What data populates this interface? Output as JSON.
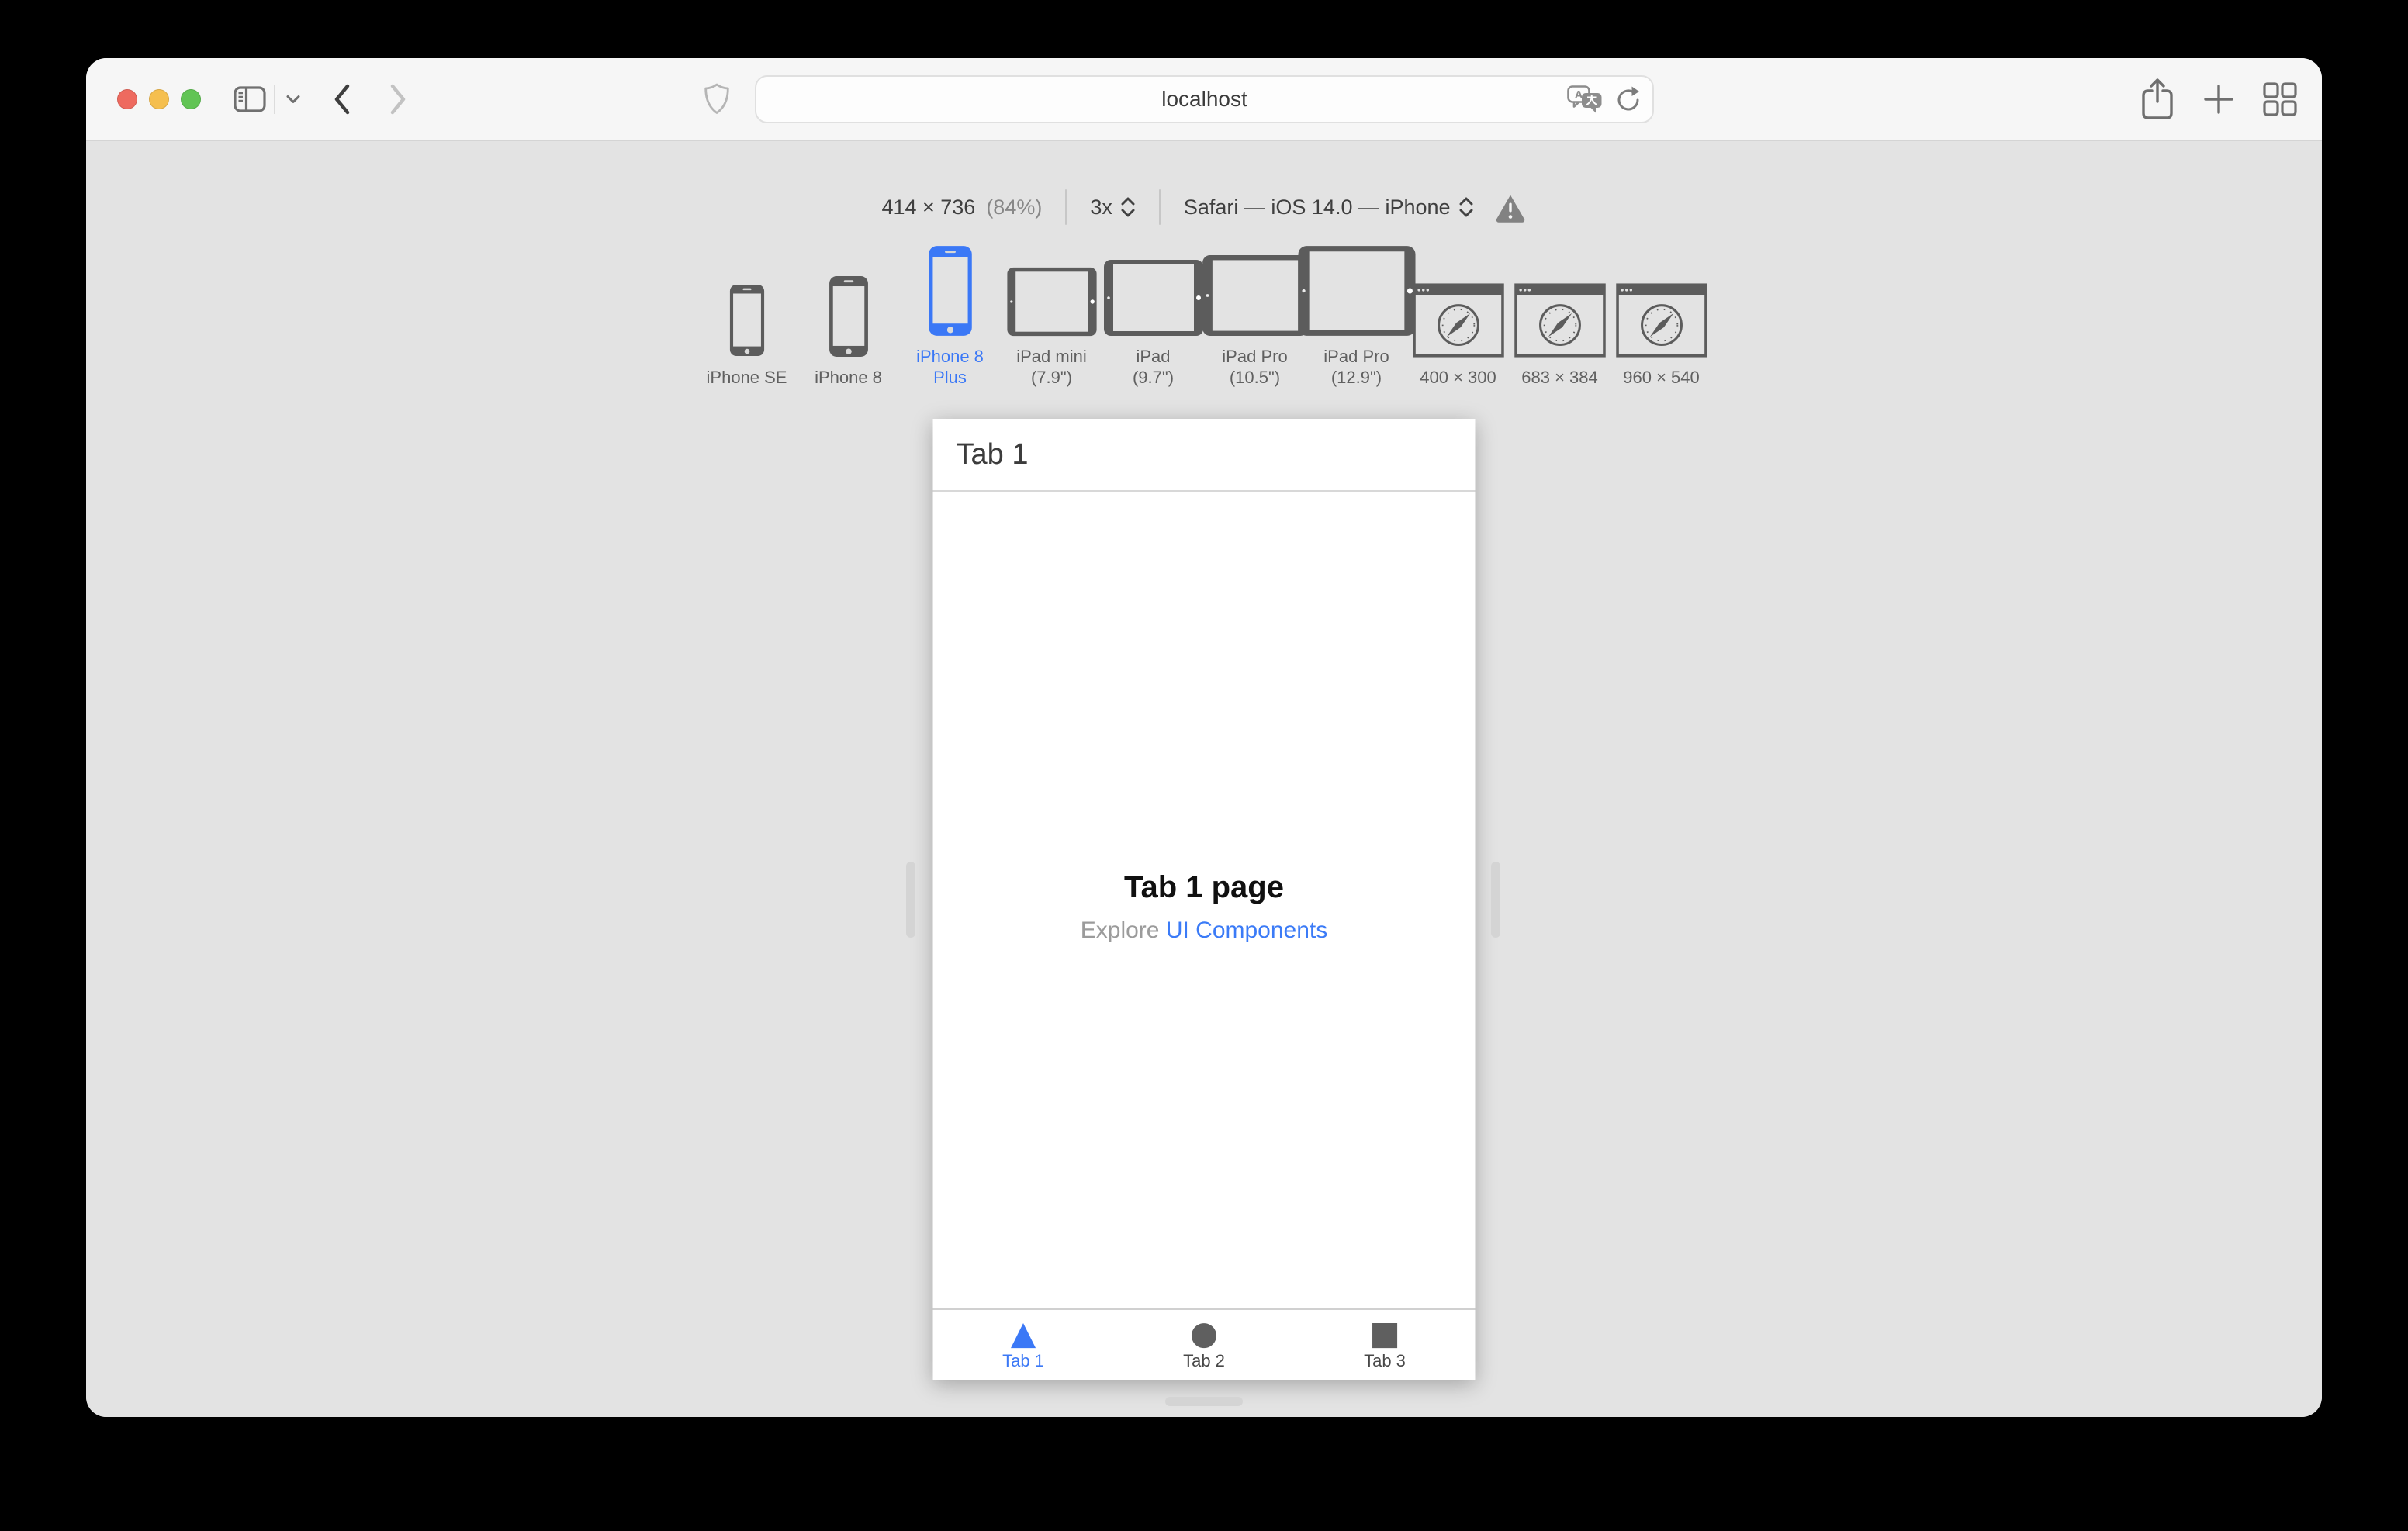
{
  "titlebar": {
    "url": "localhost"
  },
  "rdm": {
    "size": "414 × 736",
    "zoom": "(84%)",
    "pixel_ratio": "3x",
    "environment": "Safari — iOS 14.0 — iPhone"
  },
  "devices": [
    {
      "lines": [
        "iPhone SE"
      ],
      "selected": false
    },
    {
      "lines": [
        "iPhone 8"
      ],
      "selected": false
    },
    {
      "lines": [
        "iPhone 8",
        "Plus"
      ],
      "selected": true
    },
    {
      "lines": [
        "iPad mini",
        "(7.9\")"
      ],
      "selected": false
    },
    {
      "lines": [
        "iPad",
        "(9.7\")"
      ],
      "selected": false
    },
    {
      "lines": [
        "iPad Pro",
        "(10.5\")"
      ],
      "selected": false
    },
    {
      "lines": [
        "iPad Pro",
        "(12.9\")"
      ],
      "selected": false
    },
    {
      "lines": [
        "400 × 300"
      ],
      "selected": false
    },
    {
      "lines": [
        "683 × 384"
      ],
      "selected": false
    },
    {
      "lines": [
        "960 × 540"
      ],
      "selected": false
    }
  ],
  "viewport": {
    "nav_title": "Tab 1",
    "heading": "Tab 1 page",
    "subtext_prefix": "Explore ",
    "subtext_link": "UI Components",
    "tabs": [
      {
        "label": "Tab 1",
        "glyph": "▲",
        "active": true
      },
      {
        "label": "Tab 2",
        "glyph": "●",
        "active": false
      },
      {
        "label": "Tab 3",
        "glyph": "■",
        "active": false
      }
    ]
  },
  "colors": {
    "accent_blue": "#3b78f6",
    "link_blue": "#3b7bf7",
    "traffic_red": "#ee6a5f",
    "traffic_yellow": "#f5bf4f",
    "traffic_green": "#61c454",
    "chrome_gray": "#f6f6f6",
    "canvas_gray": "#e3e3e3"
  }
}
